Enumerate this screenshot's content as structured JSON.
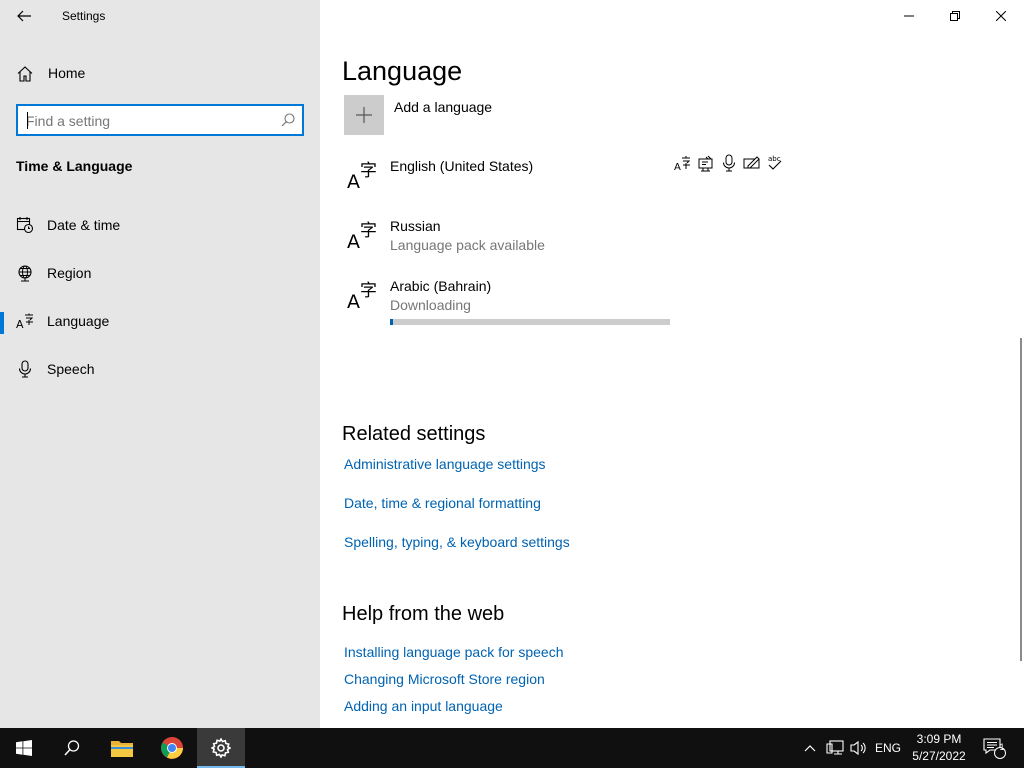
{
  "app": {
    "title": "Settings"
  },
  "sidebar": {
    "home_label": "Home",
    "search_placeholder": "Find a setting",
    "section_title": "Time & Language",
    "items": [
      {
        "label": "Date & time",
        "icon": "date-time-icon"
      },
      {
        "label": "Region",
        "icon": "globe-icon"
      },
      {
        "label": "Language",
        "icon": "language-icon",
        "selected": true
      },
      {
        "label": "Speech",
        "icon": "microphone-icon"
      }
    ]
  },
  "main": {
    "title": "Language",
    "add_language_label": "Add a language",
    "languages": [
      {
        "name": "English (United States)",
        "status": ""
      },
      {
        "name": "Russian",
        "status": "Language pack available"
      },
      {
        "name": "Arabic (Bahrain)",
        "status": "Downloading",
        "progress": 0.01
      }
    ],
    "feature_icons": [
      "display-language-icon",
      "text-to-speech-icon",
      "speech-recognition-icon",
      "handwriting-icon",
      "spell-check-icon"
    ],
    "related_title": "Related settings",
    "related_links": [
      "Administrative language settings",
      "Date, time & regional formatting",
      "Spelling, typing, & keyboard settings"
    ],
    "help_title": "Help from the web",
    "help_links": [
      "Installing language pack for speech",
      "Changing Microsoft Store region",
      "Adding an input language"
    ]
  },
  "taskbar": {
    "language": "ENG",
    "time": "3:09 PM",
    "date": "5/27/2022",
    "notification_count": "1",
    "accent_color": "#0078d7"
  }
}
